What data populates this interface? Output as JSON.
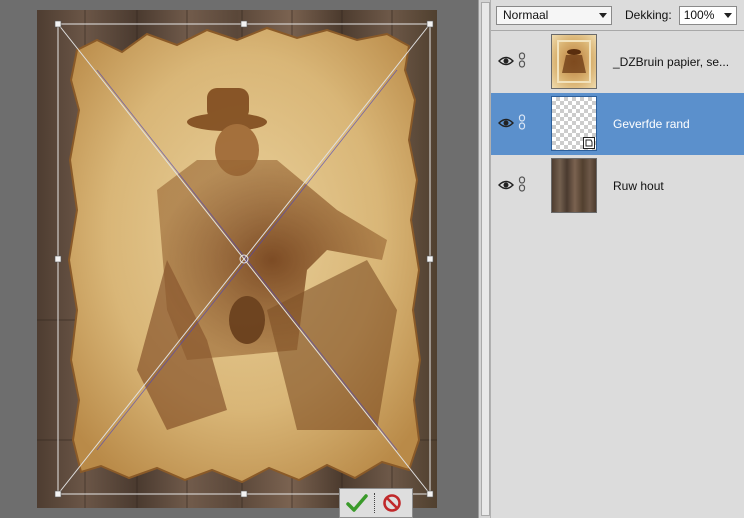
{
  "layers_panel": {
    "blend_mode": "Normaal",
    "opacity_label": "Dekking:",
    "opacity_value": "100%",
    "layers": [
      {
        "name": "_DZBruin papier, se...",
        "visible": true,
        "selected": false
      },
      {
        "name": "Geverfde rand",
        "visible": true,
        "selected": true
      },
      {
        "name": "Ruw hout",
        "visible": true,
        "selected": false
      }
    ]
  },
  "commit_bar": {
    "commit_icon": "checkmark-icon",
    "cancel_icon": "no-sign-icon"
  },
  "colors": {
    "selected_layer": "#5b90cc",
    "panel_bg": "#dcdcdc",
    "canvas_bg": "#6e6e6e",
    "commit_green": "#3a9a2a",
    "cancel_red": "#c0282a"
  }
}
